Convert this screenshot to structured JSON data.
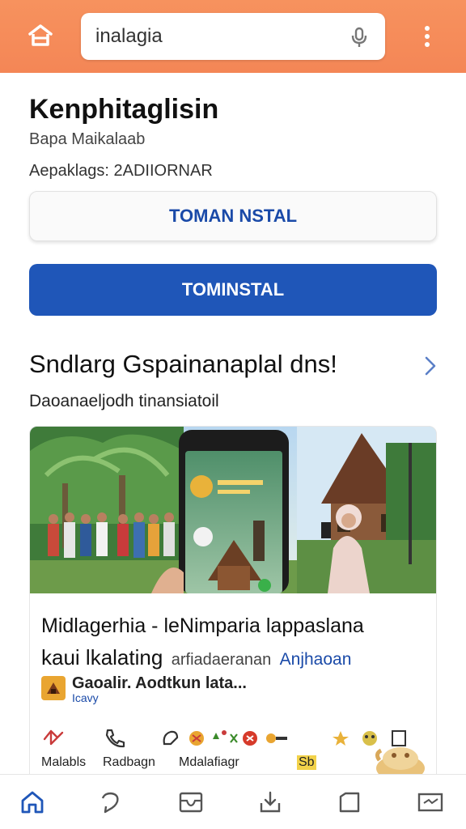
{
  "header": {
    "search_value": "inalagia",
    "icons": [
      "home-icon",
      "mic-icon",
      "more-vert-icon"
    ],
    "bar_color": "#f48656"
  },
  "app": {
    "title": "Kenphitaglisin",
    "developer": "Bapa Maikalaab",
    "meta": "Aepaklags: 2ADIIORNAR",
    "secondary_button": "TOMAN NSTAL",
    "primary_button": "TOMINSTAL",
    "accent": "#1f56b8"
  },
  "section": {
    "title": "Sndlarg Gspainanaplal dns!",
    "subtitle": "Daoanaeljodh tinansiatoil"
  },
  "card": {
    "headline": "Midlagerhia - leNimparia lappaslana",
    "line2_big": "kaui lkalating",
    "line2_small": "arfiadaeranan",
    "line2_link": "Anjhaoan",
    "source_name": "Gaoalir. Aodtkun lata...",
    "source_sub": "Icavy",
    "actions": [
      {
        "label": "Malabls",
        "icon": "share-icon"
      },
      {
        "label": "Radbagn",
        "icon": "phone-icon"
      },
      {
        "label": "Mdalafiagr",
        "icon": "reactions-icon"
      },
      {
        "label": "Sb",
        "icon": "emoji-icon"
      }
    ]
  },
  "bottom_nav": {
    "items": [
      "home-icon",
      "recent-icon",
      "inbox-icon",
      "download-icon",
      "library-icon",
      "mail-icon"
    ]
  }
}
